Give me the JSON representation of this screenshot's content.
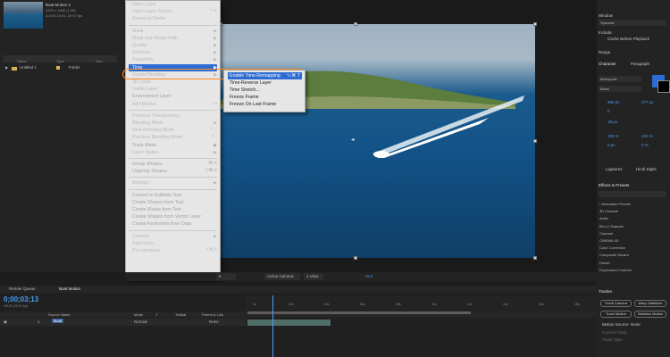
{
  "project": {
    "comp_name": "Boat Motion 3",
    "comp_meta": [
      "1920 x 1080 (1.00)",
      "Δ 0;00;18;01, 29.97 fps"
    ],
    "columns": [
      "Name",
      "Type",
      "Size"
    ],
    "rows": [
      {
        "name": "Untitled 1",
        "type": "Folder"
      }
    ]
  },
  "context_menu": {
    "items": [
      {
        "label": "Open Layer",
        "disabled": false
      },
      {
        "label": "Open Layer Source",
        "shortcut": "⌥ E",
        "disabled": false
      },
      {
        "label": "Reveal in Finder",
        "disabled": false
      },
      {
        "sep": true
      },
      {
        "label": "Mask",
        "submenu": true
      },
      {
        "label": "Mask and Shape Path",
        "submenu": true
      },
      {
        "label": "Quality",
        "submenu": true
      },
      {
        "label": "Switches",
        "submenu": true
      },
      {
        "label": "Transform",
        "submenu": true
      },
      {
        "label": "Time",
        "submenu": true,
        "active": true
      },
      {
        "label": "Frame Blending",
        "submenu": true
      },
      {
        "label": "3D Layer"
      },
      {
        "label": "Guide Layer"
      },
      {
        "label": "Environment Layer",
        "disabled": true
      },
      {
        "label": "Add Marker",
        "shortcut": "* 8"
      },
      {
        "sep": true
      },
      {
        "label": "Preserve Transparency"
      },
      {
        "label": "Blending Mode",
        "submenu": true
      },
      {
        "label": "Next Blending Mode",
        "shortcut": "⇧ ="
      },
      {
        "label": "Previous Blending Mode",
        "shortcut": "⇧ -"
      },
      {
        "label": "Track Matte",
        "submenu": true,
        "disabled": true
      },
      {
        "label": "Layer Styles",
        "submenu": true
      },
      {
        "sep": true
      },
      {
        "label": "Group Shapes",
        "shortcut": "⌘ G",
        "disabled": true
      },
      {
        "label": "Ungroup Shapes",
        "shortcut": "⇧⌘ G",
        "disabled": true
      },
      {
        "sep": true
      },
      {
        "label": "Arrange",
        "submenu": true
      },
      {
        "sep": true
      },
      {
        "label": "Convert to Editable Text",
        "disabled": true
      },
      {
        "label": "Create Shapes from Text",
        "disabled": true
      },
      {
        "label": "Create Masks from Text",
        "disabled": true
      },
      {
        "label": "Create Shapes from Vector Layer",
        "disabled": true
      },
      {
        "label": "Create Keyframes from Data",
        "disabled": true
      },
      {
        "sep": true
      },
      {
        "label": "Camera",
        "submenu": true
      },
      {
        "label": "Auto-trace..."
      },
      {
        "label": "Pre-compose...",
        "shortcut": "⇧⌘ C"
      }
    ]
  },
  "time_submenu": {
    "items": [
      {
        "label": "Enable Time Remapping",
        "shortcut": "⌥⌘ T",
        "active": true
      },
      {
        "label": "Time-Reverse Layer",
        "shortcut": "⌥⌘ R"
      },
      {
        "label": "Time Stretch..."
      },
      {
        "label": "Freeze Frame"
      },
      {
        "label": "Freeze On Last Frame"
      }
    ]
  },
  "viewer_toolbar": {
    "camera": "Active Camera",
    "views": "1 View",
    "exposure": "+0.0"
  },
  "right_panel": {
    "info_label": "Window",
    "specular": "Specular",
    "include": "Include:",
    "cache_before_playback": "Cache Before Playback",
    "range": "Range",
    "character_tab": "Character",
    "paragraph_tab": "Paragraph",
    "font": "Metropolis",
    "style": "Black",
    "font_size": "300 px",
    "leading": "377 px",
    "tracking": "0",
    "stroke_width": "18 px",
    "vert_scale": "100 %",
    "horiz_scale": "100 %",
    "baseline": "0 px",
    "tsume": "0 %",
    "ligatures": "Ligatures",
    "hindi_digits": "Hindi Digits",
    "effects_title": "Effects & Presets",
    "effects": [
      "* Animation Presets",
      "3D Channel",
      "Audio",
      "Blur & Sharpen",
      "Channel",
      "CINEMA 4D",
      "Color Correction",
      "Composite Wizard",
      "Distort",
      "Expression Controls"
    ],
    "accent_color": "#2c6bd2"
  },
  "timeline": {
    "tabs": [
      "Render Queue",
      "Boat Motion"
    ],
    "timecode": "0;00;03;13",
    "timecode_sub": "00103 (29.97 fps)",
    "columns": [
      "Source Name",
      "Mode",
      "T",
      "TrkMat",
      "Parent & Link"
    ],
    "layer": {
      "index": "1",
      "name": "Boat",
      "mode": "Normal",
      "parent": "None"
    },
    "ruler_ticks": [
      "0s",
      "02s",
      "04s",
      "06s",
      "08s",
      "10s",
      "12s",
      "14s",
      "16s",
      "18s"
    ]
  },
  "tracker": {
    "title": "Tracker",
    "buttons": [
      "Track Camera",
      "Warp Stabilizer",
      "Track Motion",
      "Stabilize Motion"
    ],
    "motion_source_label": "Motion Source:",
    "motion_source_value": "None",
    "current_track_label": "Current Track:",
    "track_type_label": "Track Type:"
  }
}
